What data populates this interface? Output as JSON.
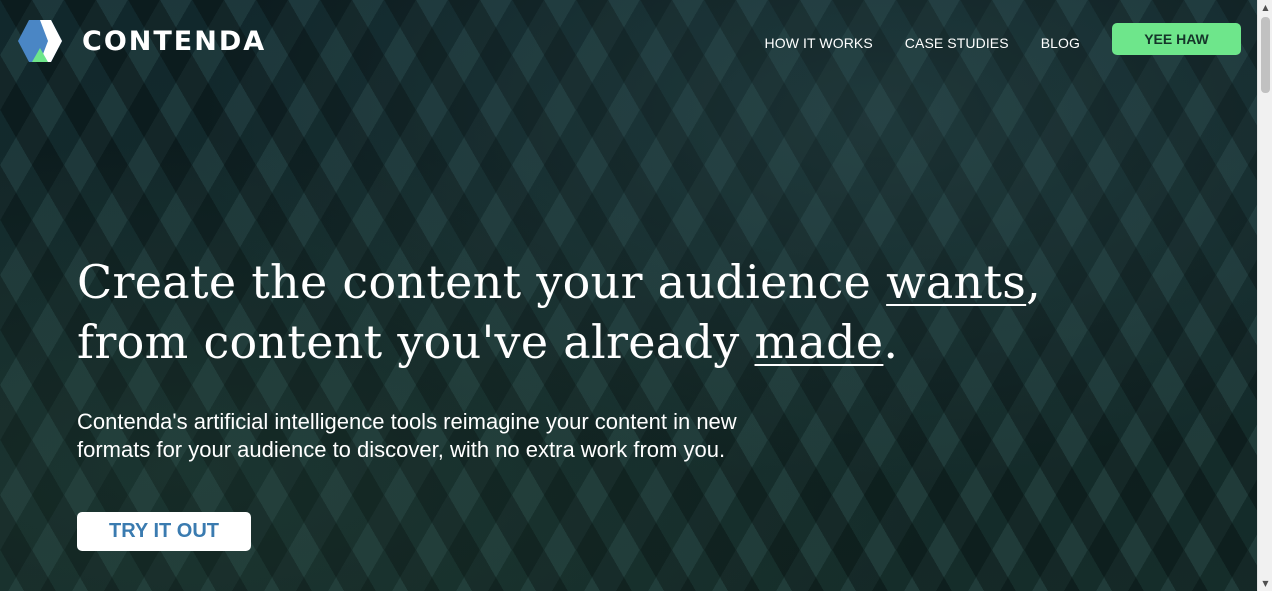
{
  "brand": {
    "name": "CONTENDA",
    "logo_icon": "hexagon-logo-icon",
    "colors": {
      "blue": "#4a86c5",
      "green": "#6ee68b",
      "white": "#ffffff"
    }
  },
  "nav": {
    "links": [
      "HOW IT WORKS",
      "CASE STUDIES",
      "BLOG"
    ],
    "cta": "YEE HAW"
  },
  "hero": {
    "headline": {
      "line1_pre": "Create the content your audience ",
      "line1_emph": "wants",
      "line1_post": ",",
      "line2_pre": "from content you've already ",
      "line2_emph": "made",
      "line2_post": "."
    },
    "subhead": "Contenda's artificial intelligence tools reimagine your content in new formats for your audience to discover, with no extra work from you.",
    "cta": "TRY IT OUT"
  },
  "scrollbar": {
    "up_icon": "arrow-up-icon",
    "down_icon": "arrow-down-icon"
  }
}
